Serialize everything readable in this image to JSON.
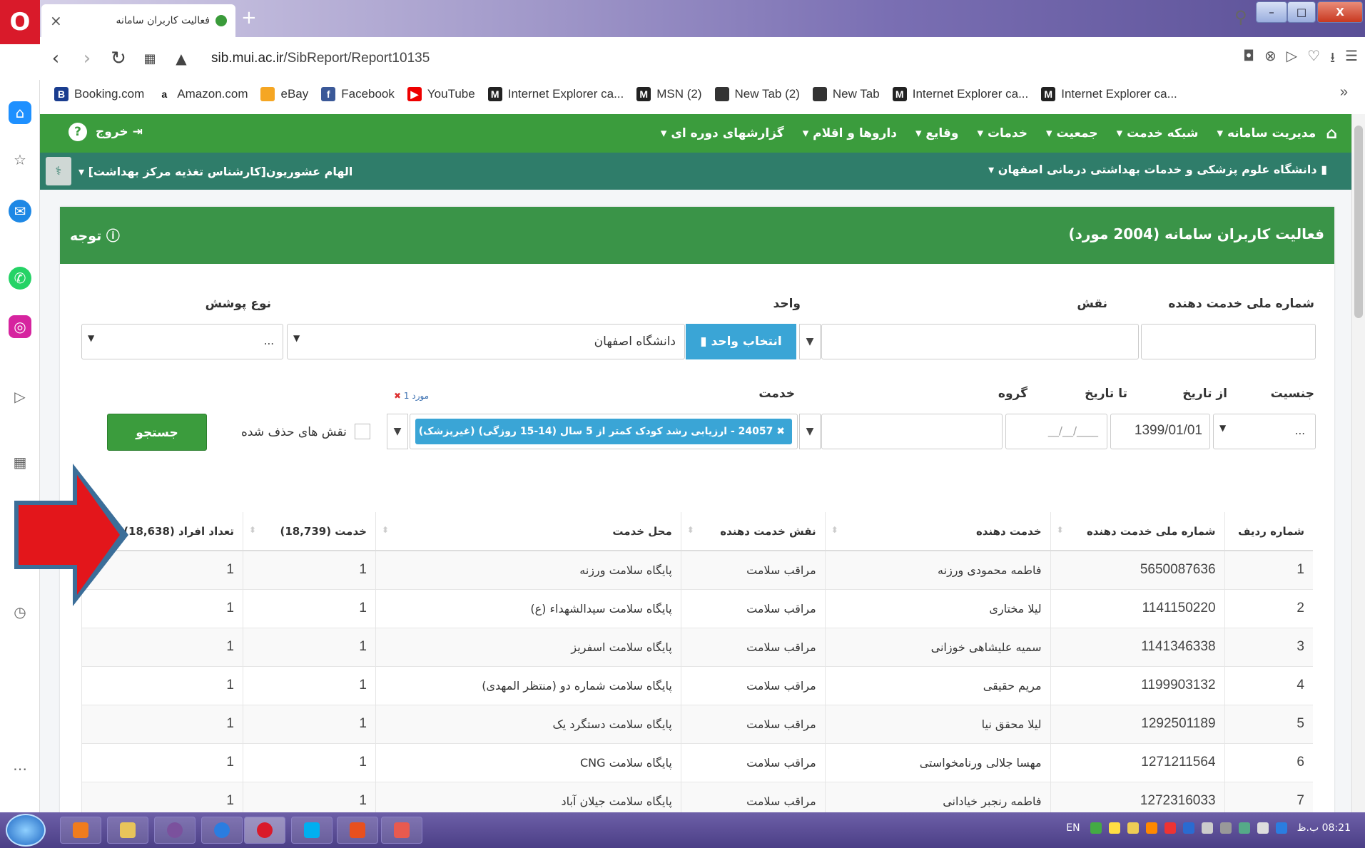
{
  "browser": {
    "tab_title": "فعالیت کاربران سامانه",
    "url_domain": "sib.mui.ac.ir",
    "url_path": "/SibReport/Report10135",
    "bookmarks": [
      "Booking.com",
      "Amazon.com",
      "eBay",
      "Facebook",
      "YouTube",
      "Internet Explorer ca...",
      "MSN (2)",
      "New Tab (2)",
      "New Tab",
      "Internet Explorer ca...",
      "Internet Explorer ca..."
    ]
  },
  "nav": {
    "items": [
      "مدیریت سامانه",
      "شبکه خدمت",
      "جمعیت",
      "خدمات",
      "وقایع",
      "داروها و اقلام",
      "گزارشهای دوره ای"
    ],
    "logout": "خروج",
    "university": "دانشگاه علوم پزشکی و خدمات بهداشتی درمانی اصفهان",
    "user": "الهام عشوریون[کارشناس تغذیه مرکز بهداشت]"
  },
  "panel": {
    "title": "فعالیت کاربران سامانه (2004 مورد)",
    "note": "توجه"
  },
  "filters": {
    "national_id_label": "شماره ملی خدمت دهنده",
    "role_label": "نقش",
    "unit_label": "واحد",
    "unit_button": "انتخاب واحد",
    "unit_value": "دانشگاه اصفهان",
    "coverage_label": "نوع پوشش",
    "coverage_value": "...",
    "gender_label": "جنسیت",
    "gender_value": "...",
    "from_date_label": "از تاریخ",
    "from_date_value": "1399/01/01",
    "to_date_label": "تا تاریخ",
    "to_date_value": "__/__/____",
    "group_label": "گروه",
    "service_label": "خدمت",
    "service_chip": "24057 - ارزیابی رشد کودک کمتر از 5 سال (14-15 روزگی) (غیرپزشک)",
    "service_count": "1 مورد",
    "deleted_roles_label": "نقش های حذف شده",
    "search_button": "جستجو"
  },
  "table": {
    "headers": [
      "شماره ردیف",
      "شماره ملی خدمت دهنده",
      "خدمت دهنده",
      "نقش خدمت دهنده",
      "محل خدمت",
      "خدمت (18,739)",
      "تعداد افراد (18,638)"
    ],
    "rows": [
      [
        "1",
        "5650087636",
        "فاطمه محمودی ورزنه",
        "مراقب سلامت",
        "پایگاه سلامت ورزنه",
        "1",
        "1"
      ],
      [
        "2",
        "1141150220",
        "لیلا مختاری",
        "مراقب سلامت",
        "پایگاه سلامت سیدالشهداء (ع)",
        "1",
        "1"
      ],
      [
        "3",
        "1141346338",
        "سمیه علیشاهی خوزانی",
        "مراقب سلامت",
        "پایگاه سلامت اسفریز",
        "1",
        "1"
      ],
      [
        "4",
        "1199903132",
        "مریم حقیقی",
        "مراقب سلامت",
        "پایگاه سلامت شماره دو (منتظر المهدی)",
        "1",
        "1"
      ],
      [
        "5",
        "1292501189",
        "لیلا محقق نیا",
        "مراقب سلامت",
        "پایگاه سلامت دستگرد یک",
        "1",
        "1"
      ],
      [
        "6",
        "1271211564",
        "مهسا جلالی ورنامخواستی",
        "مراقب سلامت",
        "پایگاه سلامت CNG",
        "1",
        "1"
      ],
      [
        "7",
        "1272316033",
        "فاطمه رنجبر خیادانی",
        "مراقب سلامت",
        "پایگاه سلامت جیلان آباد",
        "1",
        "1"
      ]
    ]
  },
  "taskbar": {
    "lang": "EN",
    "clock": "08:21 ب.ظ"
  },
  "colors": {
    "nav_green": "#3b9c3d",
    "nav_teal": "#2f7d6a",
    "accent_blue": "#3aa5d6",
    "arrow_red": "#e3161b"
  }
}
